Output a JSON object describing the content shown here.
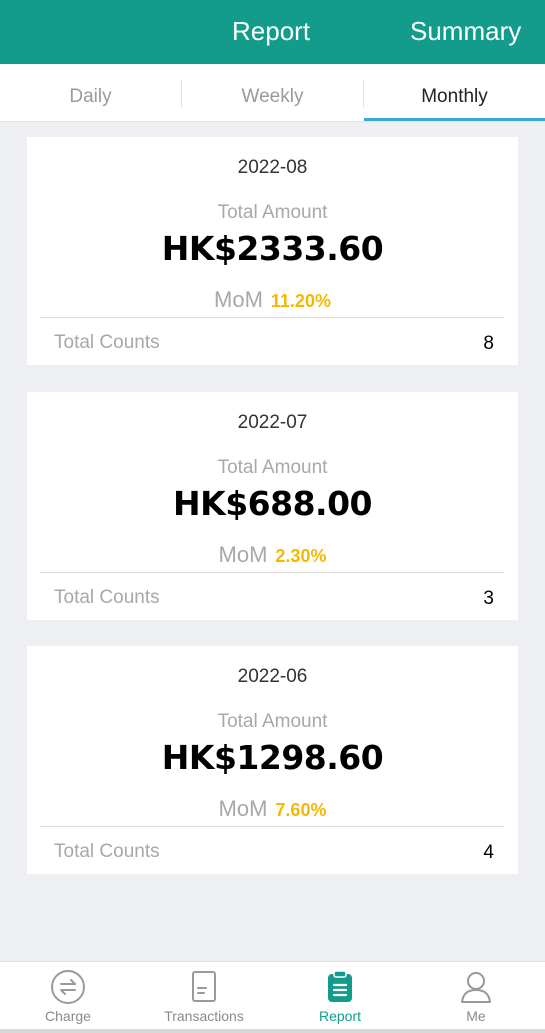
{
  "header": {
    "title": "Report",
    "summary": "Summary"
  },
  "tabs": [
    {
      "label": "Daily"
    },
    {
      "label": "Weekly"
    },
    {
      "label": "Monthly"
    }
  ],
  "active_tab": "Monthly",
  "cards": [
    {
      "month": "2022-08",
      "amount_label": "Total Amount",
      "amount": "HK$2333.60",
      "mom_label": "MoM",
      "mom_value": "11.20%",
      "count_label": "Total Counts",
      "count": "8"
    },
    {
      "month": "2022-07",
      "amount_label": "Total Amount",
      "amount": "HK$688.00",
      "mom_label": "MoM",
      "mom_value": "2.30%",
      "count_label": "Total Counts",
      "count": "3"
    },
    {
      "month": "2022-06",
      "amount_label": "Total Amount",
      "amount": "HK$1298.60",
      "mom_label": "MoM",
      "mom_value": "7.60%",
      "count_label": "Total Counts",
      "count": "4"
    }
  ],
  "bottom_nav": [
    {
      "label": "Charge",
      "icon": "swap-arrows-icon"
    },
    {
      "label": "Transactions",
      "icon": "document-icon"
    },
    {
      "label": "Report",
      "icon": "clipboard-icon"
    },
    {
      "label": "Me",
      "icon": "person-icon"
    }
  ],
  "colors": {
    "header": "#139c8c",
    "accent": "#3aa9d6",
    "mom": "#f5b800",
    "active_nav": "#139c8c"
  }
}
